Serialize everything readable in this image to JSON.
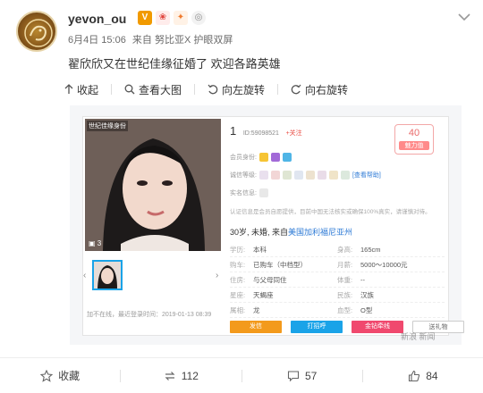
{
  "post": {
    "username": "yevon_ou",
    "meta": {
      "date": "6月4日 15:06",
      "source": "来自 努比亚X 护眼双屏"
    },
    "text": "翟欣欣又在世纪佳缘征婚了 欢迎各路英雄"
  },
  "toolbar": {
    "collapse": "收起",
    "view_large": "查看大图",
    "rotate_left": "向左旋转",
    "rotate_right": "向右旋转"
  },
  "screenshot": {
    "photo_tag": "世纪佳缘身份",
    "photo_count": "3",
    "uid_number": "1",
    "uid": "ID:59098521",
    "follow": "+关注",
    "charm_value": "40",
    "charm_label": "魅力值",
    "member_label": "会员身份:",
    "cert_label": "诚信等级:",
    "cert_link": "[查看帮助]",
    "real_label": "实名信息:",
    "cert_note": "认证信息是会员自愿提供，目前中国无法核实或确保100%真实，请谨慎对待。",
    "summary_prefix": "30岁, 未婚, 来自",
    "summary_location": "美国加利福尼亚州",
    "grid": [
      {
        "k1": "学历:",
        "v1": "本科",
        "k2": "身高:",
        "v2": "165cm"
      },
      {
        "k1": "购车:",
        "v1": "已购车（中档型）",
        "k2": "月薪:",
        "v2": "5000～10000元"
      },
      {
        "k1": "住房:",
        "v1": "与父母同住",
        "k2": "体重:",
        "v2": "--"
      },
      {
        "k1": "星座:",
        "v1": "天蝎座",
        "k2": "民族:",
        "v2": "汉族"
      },
      {
        "k1": "属相:",
        "v1": "龙",
        "k2": "血型:",
        "v2": "O型"
      }
    ],
    "login_info": "加不在线，最近登录时间：2019-01-13 08:39",
    "buttons": [
      "发信",
      "打招呼",
      "金钻牵线",
      "送礼物"
    ],
    "watermark": "新浪 新闻"
  },
  "actions": {
    "favorite": "收藏",
    "repost": "112",
    "comment": "57",
    "like": "84"
  }
}
